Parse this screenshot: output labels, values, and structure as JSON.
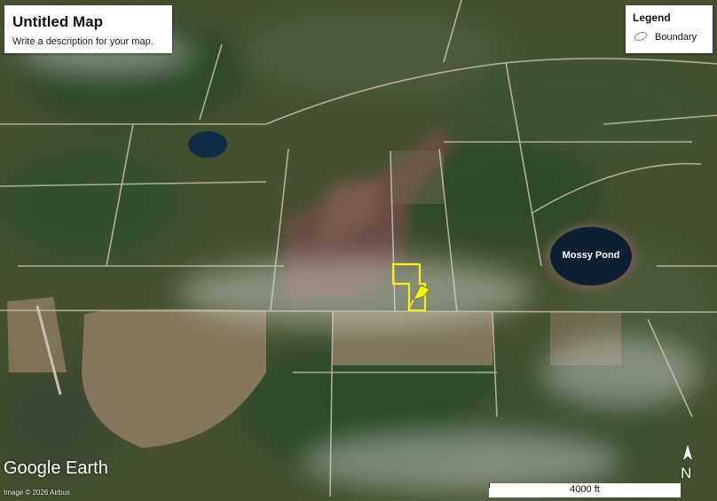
{
  "map": {
    "title": "Untitled Map",
    "description": "Write a description for your map.",
    "legend_title": "Legend",
    "legend_item": "Boundary",
    "pond_label": "Mossy Pond",
    "brand": "Google Earth",
    "credit": "Image © 2026 Airbus",
    "scale_label": "4000 ft",
    "north_label": "N",
    "boundary_color": "#f7f017",
    "colors": {
      "terrain": "#3f4a33",
      "pond": "#0c1f33"
    }
  }
}
